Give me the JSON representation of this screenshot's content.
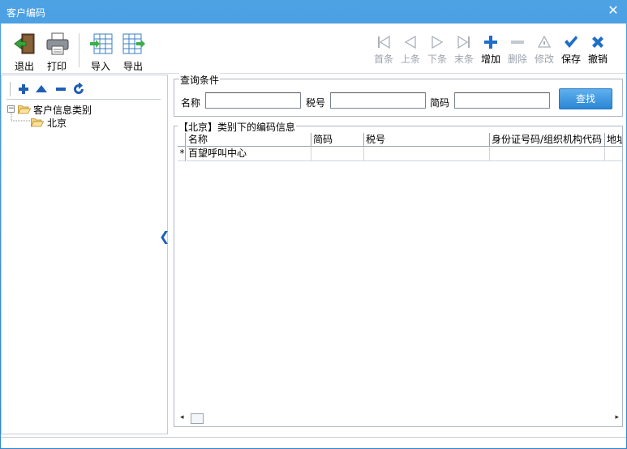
{
  "window": {
    "title": "客户编码",
    "close_glyph": "✕"
  },
  "toolbar": {
    "exit": "退出",
    "print": "打印",
    "import": "导入",
    "export": "导出"
  },
  "nav": {
    "first": "首条",
    "prev": "上条",
    "next": "下条",
    "last": "末条",
    "add": "增加",
    "delete": "删除",
    "edit": "修改",
    "save": "保存",
    "cancel": "撤销"
  },
  "tree": {
    "root": "客户信息类别",
    "child": "北京",
    "expander": "−"
  },
  "query": {
    "legend": "查询条件",
    "name_label": "名称",
    "tax_label": "税号",
    "code_label": "简码",
    "name_value": "",
    "tax_value": "",
    "code_value": "",
    "search_button": "查找"
  },
  "grid": {
    "legend": "【北京】类别下的编码信息",
    "columns": [
      "名称",
      "简码",
      "税号",
      "身份证号码/组织机构代码",
      "地址"
    ],
    "rows": [
      {
        "marker": "*",
        "cells": [
          "百望呼叫中心",
          "",
          "",
          "",
          ""
        ]
      }
    ]
  },
  "colors": {
    "title_bar": "#3a8fd6",
    "accent_blue": "#2b86d6",
    "icon_blue": "#1d61b8",
    "disabled_gray": "#9ba3ad"
  }
}
